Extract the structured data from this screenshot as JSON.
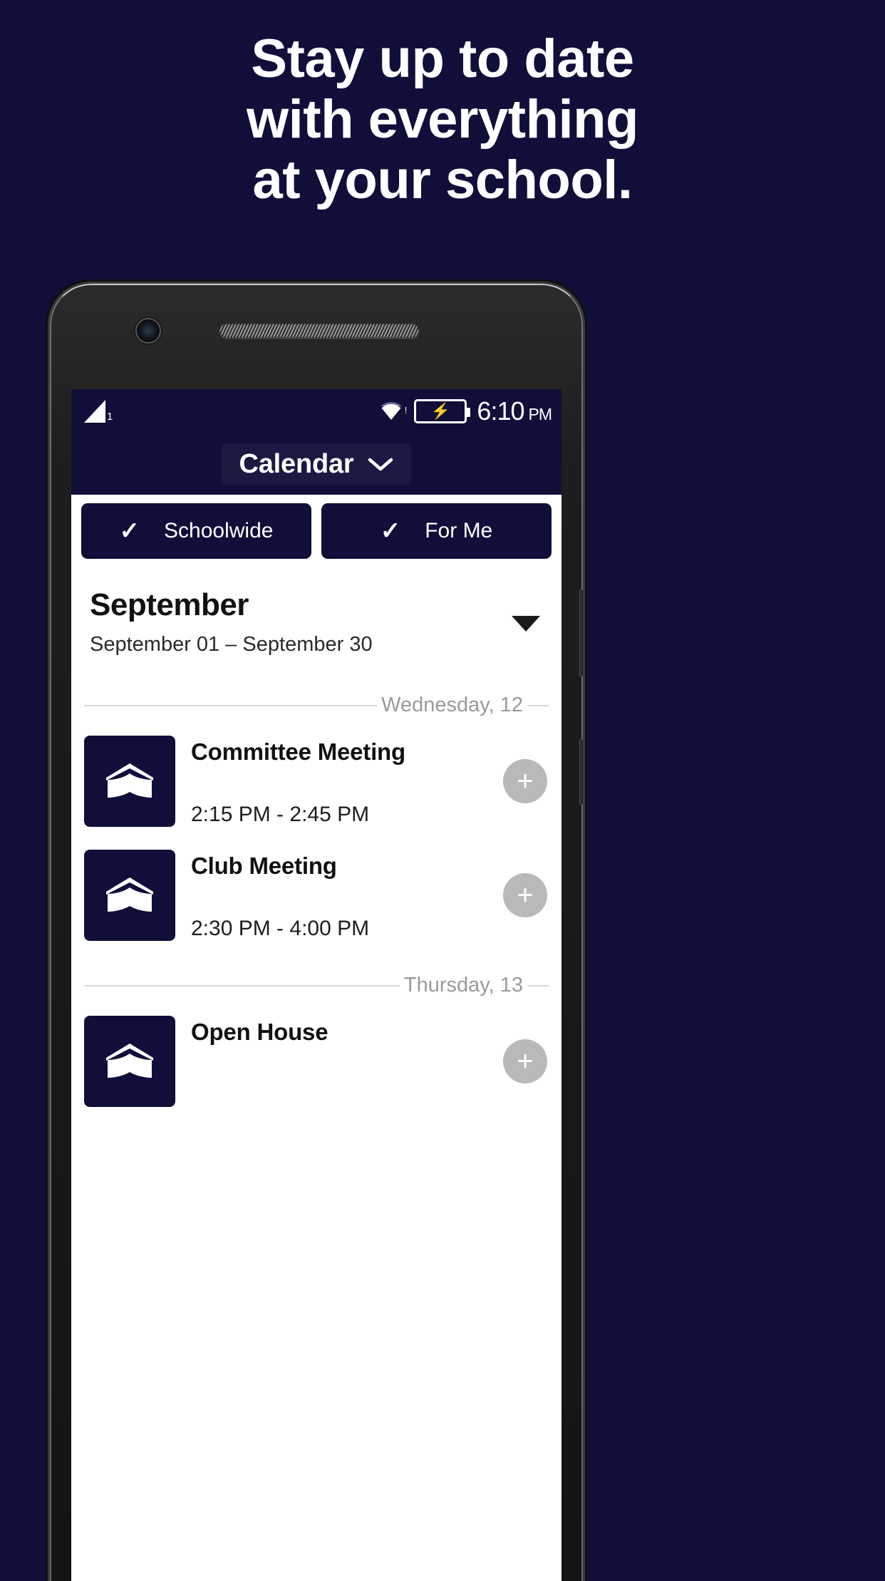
{
  "promo": {
    "lines": [
      "Stay up to date",
      "with everything",
      "at your school."
    ],
    "bg_color": "#100f3a",
    "text_color": "#ffffff"
  },
  "phone": {
    "camera_icon": "front-camera-icon",
    "speaker_icon": "earpiece-speaker-icon"
  },
  "statusbar": {
    "signal_icon": "cell-signal-icon",
    "signal_badge": "1",
    "wifi_icon": "wifi-icon",
    "wifi_alert": "!",
    "battery_icon": "battery-charging-icon",
    "battery_bolt": "⚡",
    "time": "6:10",
    "ampm": "PM"
  },
  "navbar": {
    "title": "Calendar",
    "chevron_icon": "chevron-down-icon"
  },
  "filters": [
    {
      "label": "Schoolwide",
      "checked": true,
      "check_glyph": "✓"
    },
    {
      "label": "For Me",
      "checked": true,
      "check_glyph": "✓"
    }
  ],
  "month": {
    "title": "September",
    "range": "September 01 – September 30",
    "caret_icon": "caret-down-icon"
  },
  "days": [
    {
      "label": "Wednesday, 12",
      "events": [
        {
          "title": "Committee Meeting",
          "time": "2:15 PM - 2:45 PM",
          "thumb_icon": "open-book-icon",
          "add_label": "+"
        },
        {
          "title": "Club Meeting",
          "time": "2:30 PM - 4:00 PM",
          "thumb_icon": "open-book-icon",
          "add_label": "+"
        }
      ]
    },
    {
      "label": "Thursday, 13",
      "events": [
        {
          "title": "Open House",
          "time": "",
          "thumb_icon": "open-book-icon",
          "add_label": "+"
        }
      ]
    }
  ],
  "colors": {
    "brand_navy": "#100f3a",
    "divider_gray": "#d8d8d8",
    "muted_text": "#9a9a9a",
    "add_button_gray": "#b9b9b9"
  }
}
